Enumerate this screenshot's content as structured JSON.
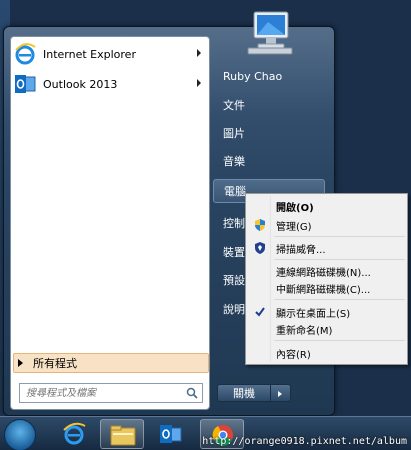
{
  "start_menu": {
    "pinned": [
      {
        "label": "Internet Explorer",
        "icon": "internet-explorer-icon"
      },
      {
        "label": "Outlook 2013",
        "icon": "outlook-icon"
      }
    ],
    "all_programs": "所有程式",
    "search_placeholder": "搜尋程式及檔案"
  },
  "right_pane": {
    "user_name": "Ruby Chao",
    "items": [
      "文件",
      "圖片",
      "音樂",
      "電腦",
      "控制台",
      "裝置和印表機",
      "預設程式",
      "說明及支援"
    ],
    "shutdown_label": "關機"
  },
  "context_menu": {
    "items": [
      {
        "label": "開啟(O)",
        "bold": true,
        "icon": ""
      },
      {
        "label": "管理(G)",
        "bold": false,
        "icon": "shield-icon"
      },
      {
        "label": "掃描威脅...",
        "bold": false,
        "icon": "defender-shield-icon"
      },
      {
        "label": "連線網路磁碟機(N)...",
        "bold": false,
        "icon": ""
      },
      {
        "label": "中斷網路磁碟機(C)...",
        "bold": false,
        "icon": ""
      },
      {
        "label": "顯示在桌面上(S)",
        "bold": false,
        "icon": "checkmark-icon",
        "checked": true
      },
      {
        "label": "重新命名(M)",
        "bold": false,
        "icon": ""
      },
      {
        "label": "內容(R)",
        "bold": false,
        "icon": ""
      }
    ]
  },
  "taskbar": {
    "watermark": "http://orange0918.pixnet.net/album"
  }
}
